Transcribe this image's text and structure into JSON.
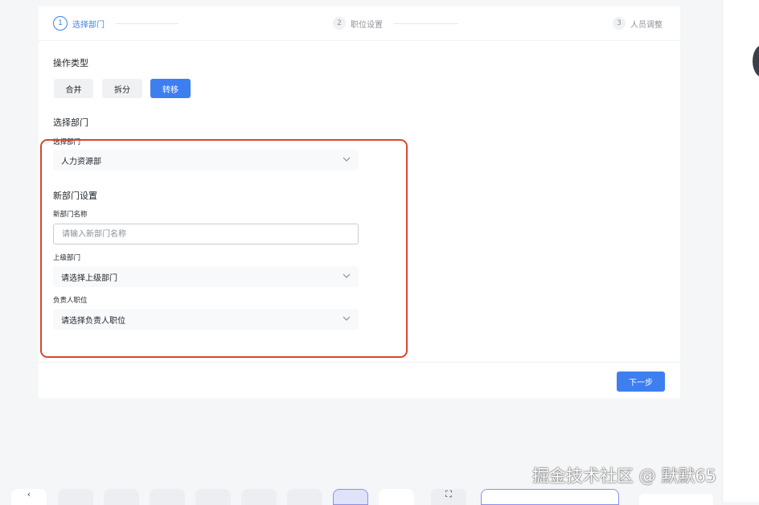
{
  "stepper": {
    "steps": [
      {
        "number": "1",
        "label": "选择部门"
      },
      {
        "number": "2",
        "label": "职位设置"
      },
      {
        "number": "3",
        "label": "人员调整"
      }
    ]
  },
  "operation": {
    "title": "操作类型",
    "buttons": [
      "合并",
      "拆分",
      "转移"
    ],
    "selected": "转移"
  },
  "select_department": {
    "title": "选择部门",
    "field_label": "选择部门",
    "value": "人力资源部"
  },
  "new_department": {
    "title": "新部门设置",
    "name_label": "新部门名称",
    "name_placeholder": "请输入新部门名称",
    "parent_label": "上级部门",
    "parent_value": "请选择上级部门",
    "leader_label": "负责人职位",
    "leader_value": "请选择负责人职位"
  },
  "footer": {
    "next_label": "下一步"
  },
  "watermark": "掘金技术社区 @ 默默65",
  "colors": {
    "primary": "#3d7ff0",
    "highlight": "#d9472b"
  }
}
